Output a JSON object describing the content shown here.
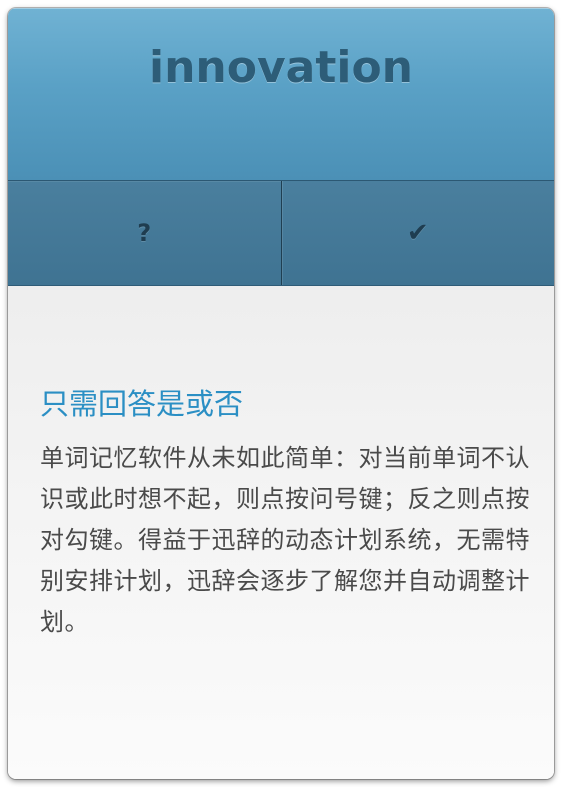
{
  "header": {
    "title": "innovation"
  },
  "buttons": {
    "unknown_label": "?",
    "known_label": "✔"
  },
  "content": {
    "heading": "只需回答是或否",
    "body": "单词记忆软件从未如此简单：对当前单词不认识或此时想不起，则点按问号键；反之则点按对勾键。得益于迅辞的动态计划系统，无需特别安排计划，迅辞会逐步了解您并自动调整计划。"
  },
  "colors": {
    "header_blue": "#5aa1c6",
    "button_bar": "#4a7f9e",
    "heading_blue": "#2b8fc4",
    "body_text": "#4a4a4a"
  }
}
